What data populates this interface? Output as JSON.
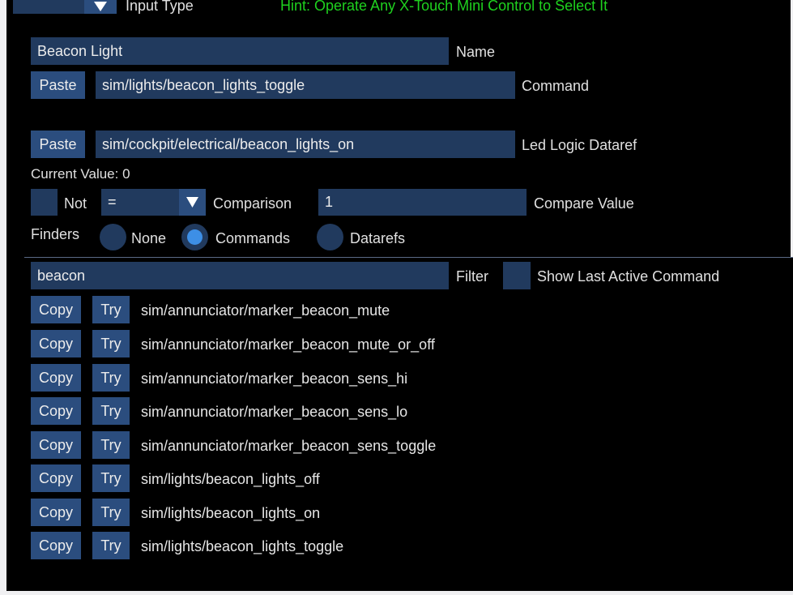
{
  "header": {
    "input_type_label": "Input Type",
    "hint": "Hint: Operate Any X-Touch Mini Control to Select It"
  },
  "name_section": {
    "name_value": "Beacon Light",
    "name_label": "Name"
  },
  "command_section": {
    "paste_label": "Paste",
    "command_value": "sim/lights/beacon_lights_toggle",
    "command_label": "Command"
  },
  "led_section": {
    "paste_label": "Paste",
    "dataref_value": "sim/cockpit/electrical/beacon_lights_on",
    "dataref_label": "Led Logic Dataref",
    "current_value": "Current Value: 0",
    "not_label": "Not",
    "comparison_operator": "=",
    "comparison_label": "Comparison",
    "compare_value": "1",
    "compare_value_label": "Compare Value"
  },
  "finders": {
    "label": "Finders",
    "options": [
      {
        "label": "None",
        "selected": false
      },
      {
        "label": "Commands",
        "selected": true
      },
      {
        "label": "Datarefs",
        "selected": false
      }
    ]
  },
  "filter": {
    "value": "beacon",
    "label": "Filter",
    "show_last_active_label": "Show Last Active Command"
  },
  "results": {
    "copy_label": "Copy",
    "try_label": "Try",
    "items": [
      "sim/annunciator/marker_beacon_mute",
      "sim/annunciator/marker_beacon_mute_or_off",
      "sim/annunciator/marker_beacon_sens_hi",
      "sim/annunciator/marker_beacon_sens_lo",
      "sim/annunciator/marker_beacon_sens_toggle",
      "sim/lights/beacon_lights_off",
      "sim/lights/beacon_lights_on",
      "sim/lights/beacon_lights_toggle"
    ]
  },
  "colors": {
    "field_bg": "#213a5e",
    "button_bg": "#2b4d7e",
    "radio_selected": "#3d8fe6",
    "hint_green": "#1fd11f",
    "window_bg": "#000000"
  }
}
